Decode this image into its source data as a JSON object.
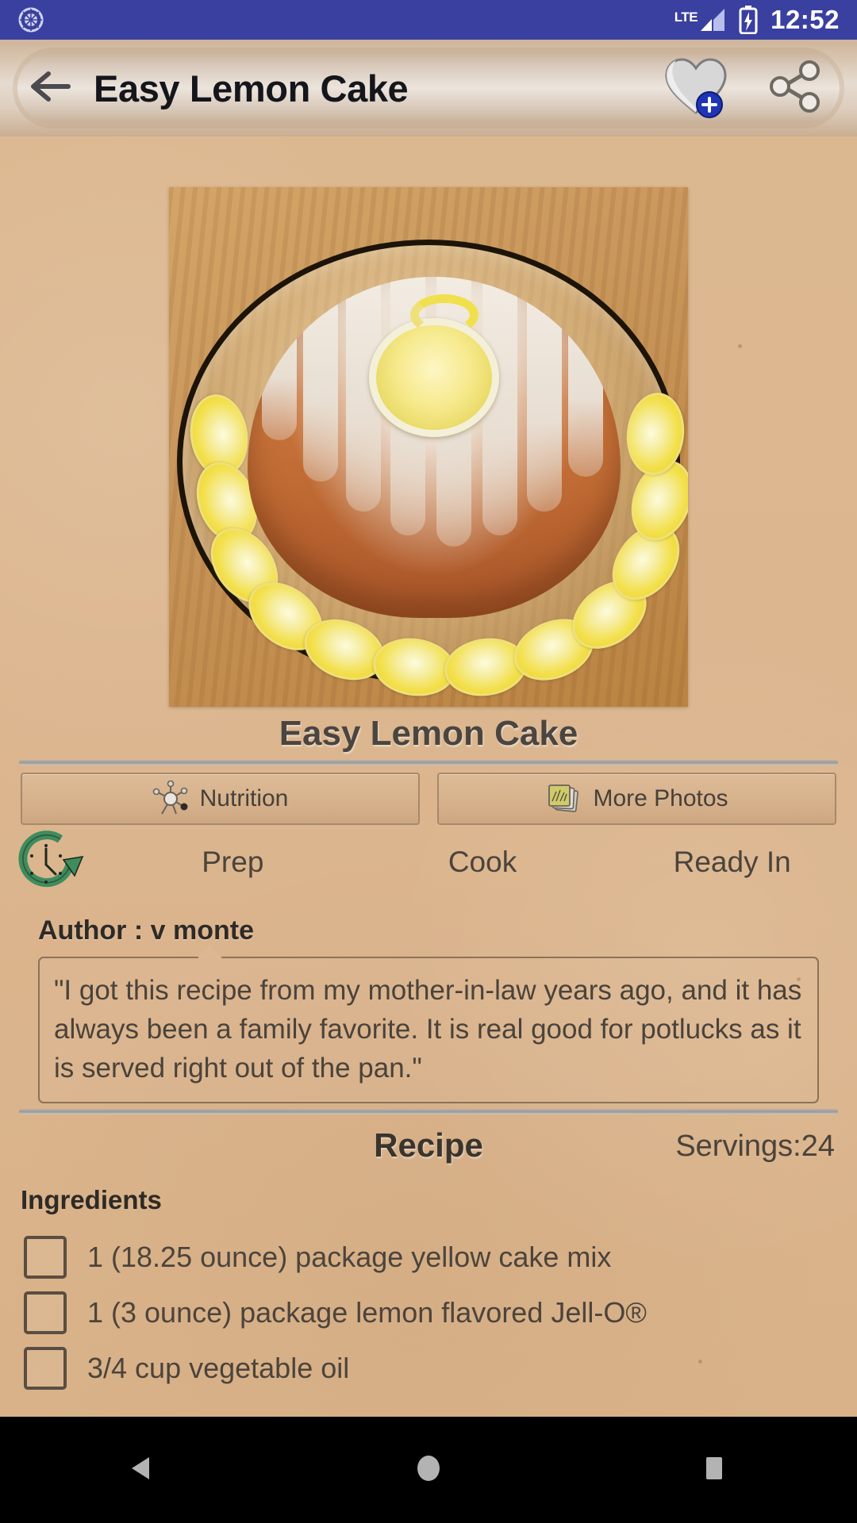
{
  "status_bar": {
    "left_icon": "shutter-icon",
    "network_label": "LTE",
    "signal_icon": "signal-bars-icon",
    "battery_icon": "battery-charging-icon",
    "time": "12:52"
  },
  "action_bar": {
    "back_icon": "arrow-back-icon",
    "title": "Easy Lemon Cake",
    "favorite_icon": "heart-add-icon",
    "share_icon": "share-icon"
  },
  "hero": {
    "image_alt": "Easy Lemon Cake bundt cake with lemon glaze and lemon slices",
    "caption": "Easy Lemon Cake"
  },
  "buttons": {
    "nutrition": {
      "label": "Nutrition",
      "icon": "molecule-icon"
    },
    "more_photos": {
      "label": "More Photos",
      "icon": "photos-stack-icon"
    }
  },
  "times": {
    "icon": "clock-refresh-icon",
    "prep_label": "Prep",
    "prep_value": "",
    "cook_label": "Cook",
    "cook_value": "",
    "ready_label": "Ready In",
    "ready_value": ""
  },
  "author": {
    "label": "Author : v monte",
    "quote": "\"I got this recipe from my mother-in-law years ago, and it has always been a family favorite. It is real good for potlucks as it is served right out of the pan.\""
  },
  "recipe": {
    "title": "Recipe",
    "servings": "Servings:24",
    "ingredients_header": "Ingredients",
    "ingredients": [
      {
        "text": "1 (18.25 ounce) package yellow cake mix",
        "checked": false
      },
      {
        "text": "1 (3 ounce) package lemon flavored Jell-O®",
        "checked": false
      },
      {
        "text": "3/4 cup vegetable oil",
        "checked": false
      }
    ]
  },
  "navbar": {
    "back": "nav-back-icon",
    "home": "nav-home-icon",
    "recents": "nav-recents-icon"
  },
  "colors": {
    "status_bar": "#3a40a0",
    "page_background": "#dcb68f",
    "accent_green": "#3f8c5e",
    "favorite_badge": "#1f35b5",
    "navbar": "#000000"
  }
}
